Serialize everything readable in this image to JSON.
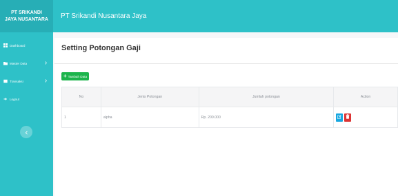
{
  "sidebar": {
    "brand_line1": "PT SRIKANDI",
    "brand_line2": "JAYA NUSANTARA",
    "items": [
      {
        "label": "Dashboard",
        "icon": "dashboard-icon",
        "has_submenu": false
      },
      {
        "label": "Master Data",
        "icon": "folder-icon",
        "has_submenu": true
      },
      {
        "label": "Transaksi",
        "icon": "cart-icon",
        "has_submenu": true
      },
      {
        "label": "Logout",
        "icon": "logout-icon",
        "has_submenu": false
      }
    ],
    "toggle_icon": "chevron-left-icon"
  },
  "header": {
    "title": "PT Srikandi Nusantara Jaya"
  },
  "page": {
    "title": "Setting Potongan Gaji",
    "add_button_label": "Tambah Data"
  },
  "table": {
    "headers": [
      "No",
      "Jenis Potongan",
      "Jumlah potongan",
      "Action"
    ],
    "rows": [
      {
        "no": "1",
        "jenis": "alpha",
        "jumlah": "Rp. 200.000"
      }
    ]
  },
  "colors": {
    "sidebar": "#2ec1c8",
    "brand": "#27aeb6",
    "add_button": "#1cb44c",
    "edit_button": "#17a7e0",
    "delete_button": "#dc3434"
  }
}
